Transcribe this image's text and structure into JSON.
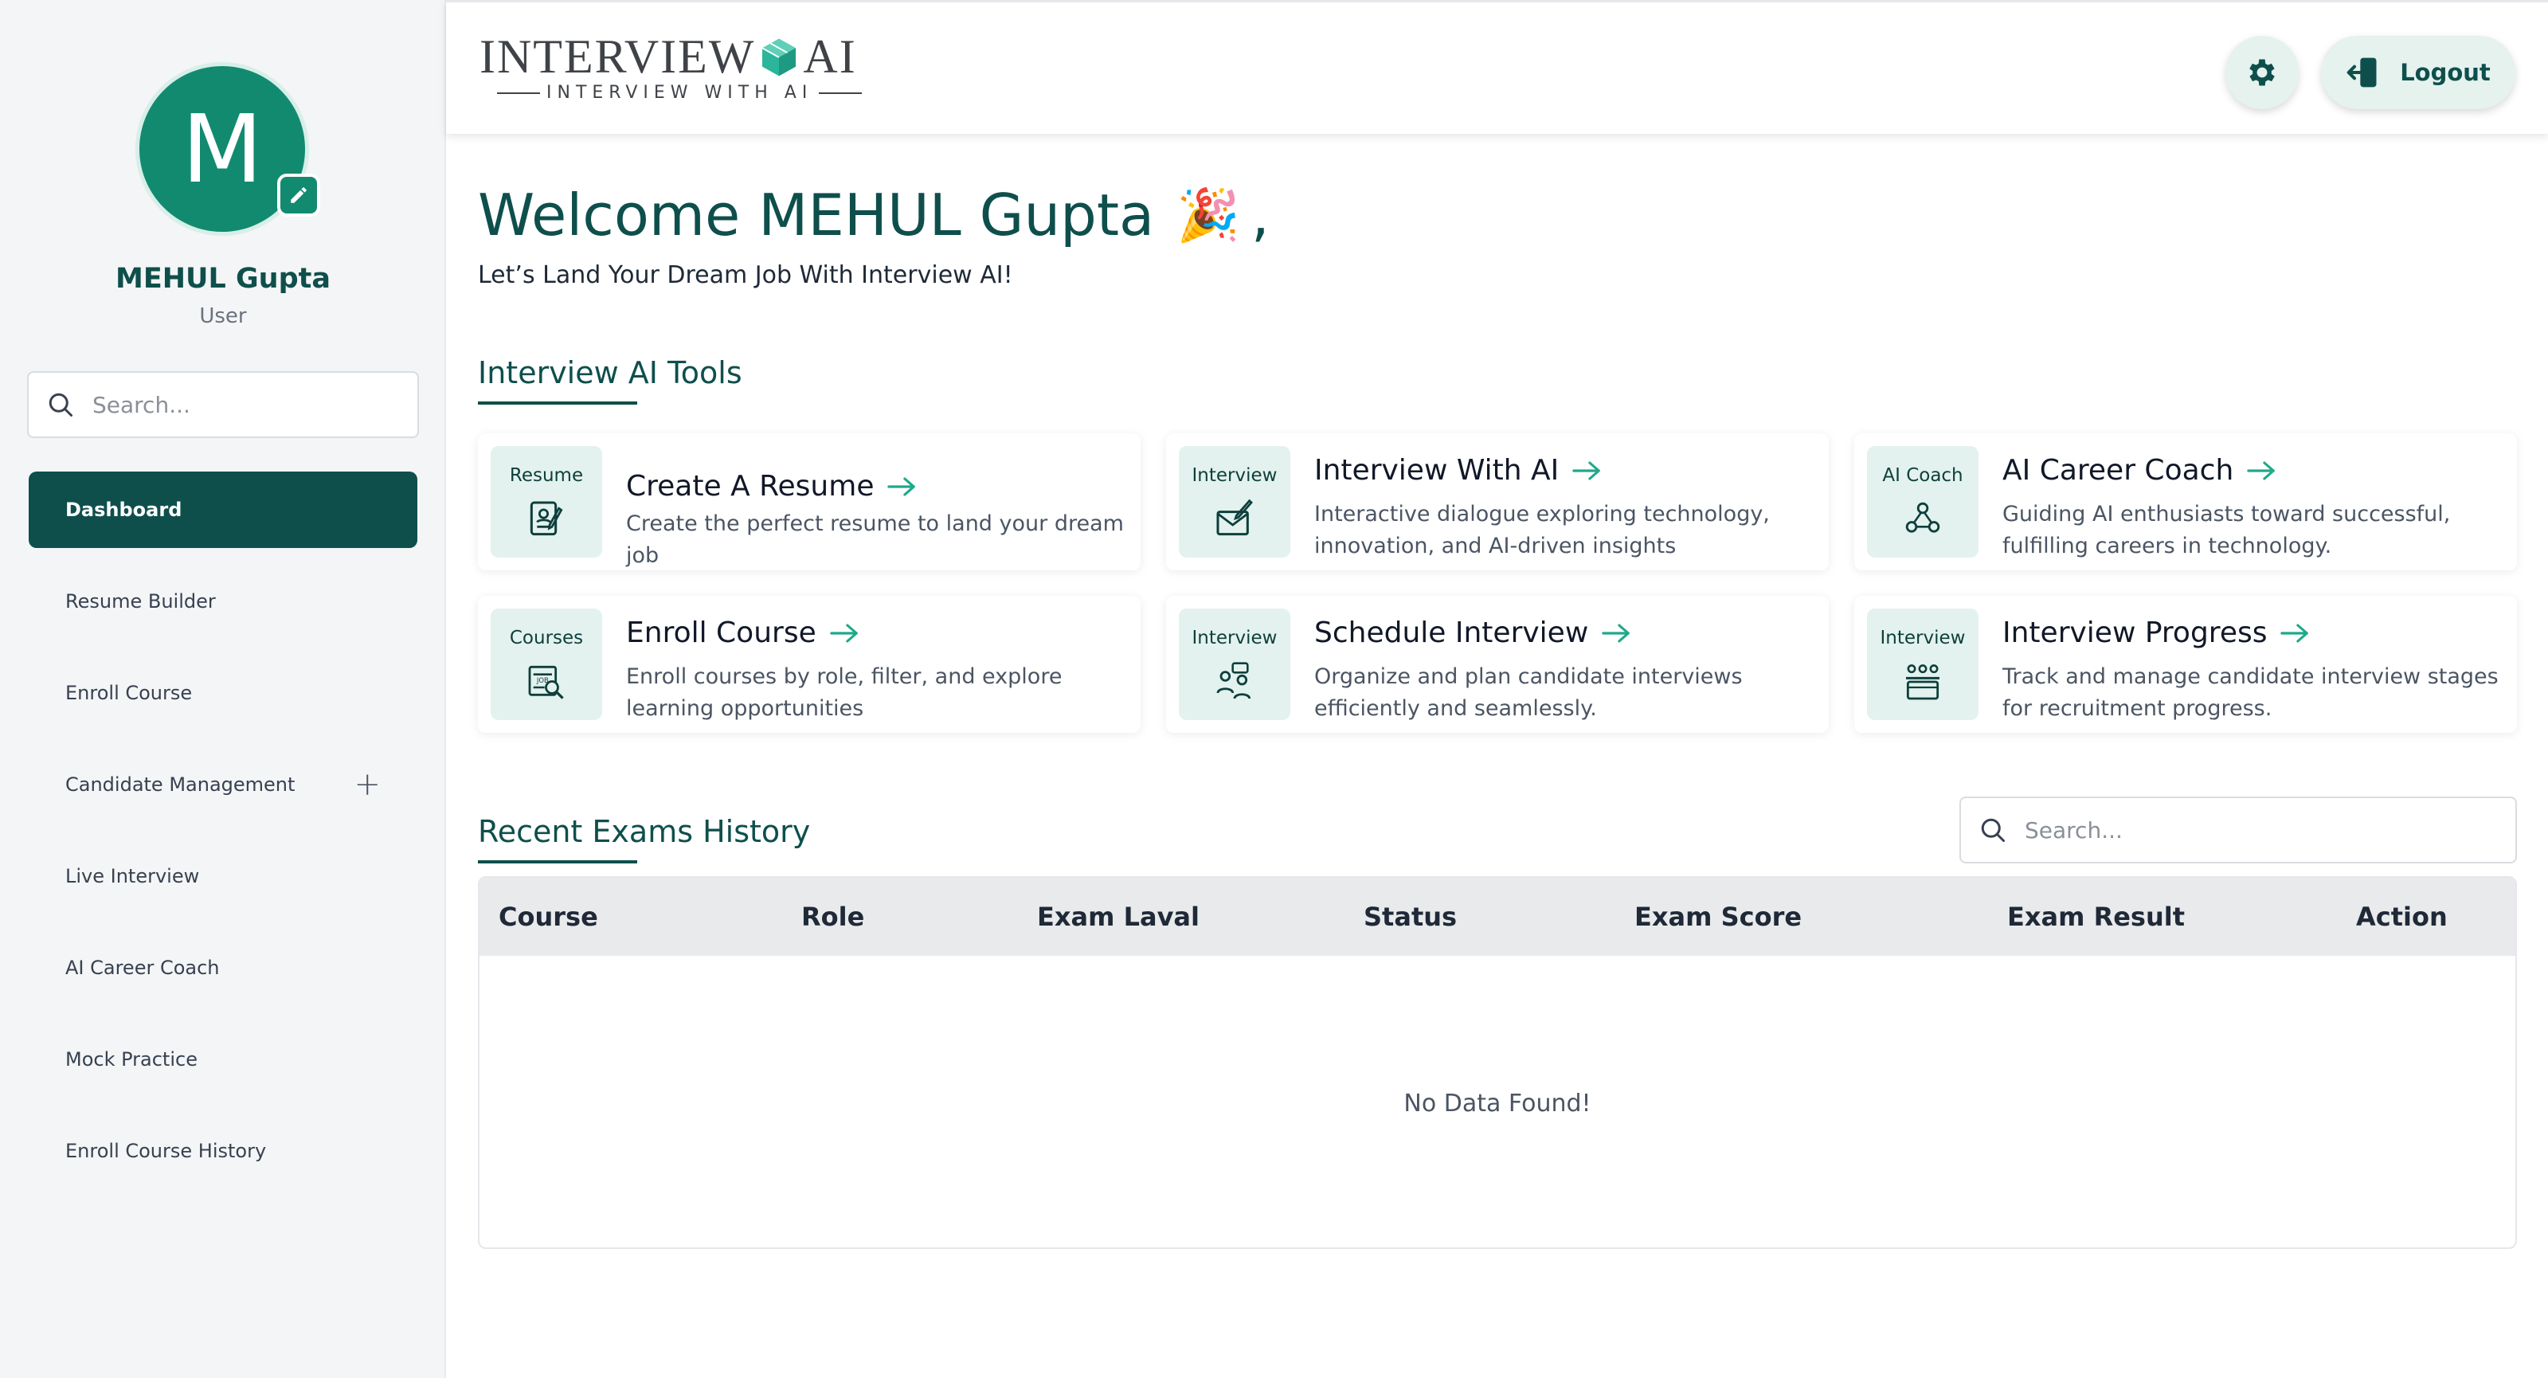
{
  "user": {
    "initial": "M",
    "name": "MEHUL Gupta",
    "role": "User"
  },
  "sidebar": {
    "search_placeholder": "Search...",
    "items": [
      {
        "label": "Dashboard",
        "active": true
      },
      {
        "label": "Resume Builder"
      },
      {
        "label": "Enroll Course"
      },
      {
        "label": "Candidate Management",
        "expandable": true
      },
      {
        "label": "Live Interview"
      },
      {
        "label": "AI Career Coach"
      },
      {
        "label": "Mock Practice"
      },
      {
        "label": "Enroll Course History"
      }
    ]
  },
  "header": {
    "logo_main": "INTERVIEW",
    "logo_ai": "AI",
    "logo_tagline": "INTERVIEW WITH AI",
    "logout_label": "Logout"
  },
  "welcome": {
    "title": "Welcome MEHUL Gupta",
    "emoji": "🎉",
    "comma": ",",
    "subtitle": "Let’s Land Your Dream Job With Interview AI!"
  },
  "tools": {
    "title": "Interview AI Tools",
    "cards": [
      {
        "tag": "Resume",
        "title": "Create A Resume",
        "desc": "Create the perfect resume to land your dream job"
      },
      {
        "tag": "Interview",
        "title": "Interview With AI",
        "desc": "Interactive dialogue exploring technology, innovation, and AI-driven insights"
      },
      {
        "tag": "AI Coach",
        "title": "AI Career Coach",
        "desc": "Guiding AI enthusiasts toward successful, fulfilling careers in technology."
      },
      {
        "tag": "Courses",
        "title": "Enroll Course",
        "desc": "Enroll courses by role, filter, and explore learning opportunities"
      },
      {
        "tag": "Interview",
        "title": "Schedule Interview",
        "desc": "Organize and plan candidate interviews efficiently and seamlessly."
      },
      {
        "tag": "Interview",
        "title": "Interview Progress",
        "desc": "Track and manage candidate interview stages for recruitment progress."
      }
    ]
  },
  "exams": {
    "title": "Recent Exams History",
    "search_placeholder": "Search...",
    "columns": [
      "Course",
      "Role",
      "Exam Laval",
      "Status",
      "Exam Score",
      "Exam Result",
      "Action"
    ],
    "empty_message": "No Data Found!"
  },
  "colors": {
    "primary": "#0e4f4c",
    "accent": "#128a70",
    "tint": "#e3f2ee",
    "arrow": "#1fa98a"
  }
}
